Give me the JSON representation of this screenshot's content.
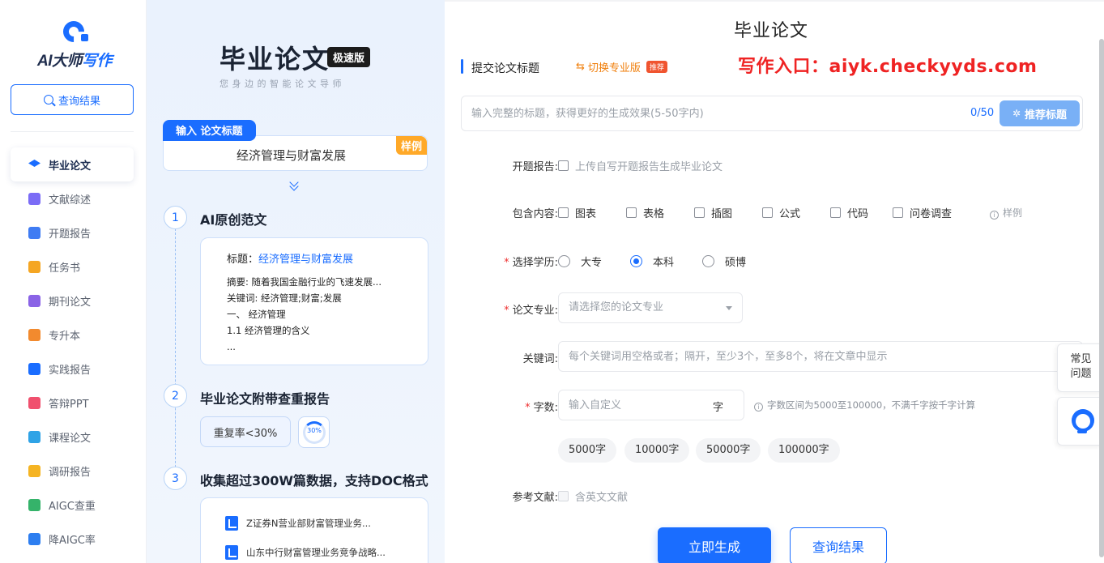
{
  "brand": {
    "logo_text_a": "AI大师",
    "logo_text_b": "写作"
  },
  "sidebar": {
    "query_button": "查询结果",
    "items": [
      {
        "label": "毕业论文",
        "icon": "graduation-cap-icon",
        "color": "#1a6dff",
        "active": true
      },
      {
        "label": "文献综述",
        "icon": "document-list-icon",
        "color": "#7b6cf6"
      },
      {
        "label": "开题报告",
        "icon": "report-icon",
        "color": "#3f7cf3"
      },
      {
        "label": "任务书",
        "icon": "task-edit-icon",
        "color": "#f5a623"
      },
      {
        "label": "期刊论文",
        "icon": "journal-icon",
        "color": "#8a63e6"
      },
      {
        "label": "专升本",
        "icon": "upgrade-icon",
        "color": "#f28a2e"
      },
      {
        "label": "实践报告",
        "icon": "practice-report-icon",
        "color": "#1a6dff"
      },
      {
        "label": "答辩PPT",
        "icon": "ppt-icon",
        "color": "#f0506e"
      },
      {
        "label": "课程论文",
        "icon": "course-paper-icon",
        "color": "#2fa3e6"
      },
      {
        "label": "调研报告",
        "icon": "survey-report-icon",
        "color": "#f5b423"
      },
      {
        "label": "AIGC查重",
        "icon": "aigc-check-icon",
        "color": "#35b36a"
      },
      {
        "label": "降AIGC率",
        "icon": "aigc-reduce-icon",
        "color": "#2d7ef0"
      }
    ]
  },
  "promo": {
    "title": "毕业论文",
    "badge": "极速版",
    "subtitle": "您身边的智能论文导师",
    "input_tag": "输入 论文标题",
    "input_value": "经济管理与财富发展",
    "sample_tag": "样例",
    "steps": [
      {
        "num": "1",
        "title": "AI原创范文"
      },
      {
        "num": "2",
        "title": "毕业论文附带查重报告"
      },
      {
        "num": "3",
        "title": "收集超过300W篇数据，支持DOC格式"
      }
    ],
    "sample": {
      "title_label": "标题：",
      "title_value": "经济管理与财富发展",
      "abstract": "摘要: 随着我国金融行业的飞速发展...",
      "keywords": "关键词: 经济管理;财富;发展",
      "h1": "一、 经济管理",
      "h11": "1.1 经济管理的含义",
      "ellipsis": "..."
    },
    "dup_rate": "重复率<30%",
    "dup_percent": "30%",
    "dup_progress": 0.3,
    "docs": [
      "Z证券N营业部财富管理业务...",
      "山东中行财富管理业务竞争战略..."
    ]
  },
  "main": {
    "title": "毕业论文",
    "section_label": "提交论文标题",
    "switch_label": "切换专业版",
    "recommend_tag": "推荐",
    "entry_text": "写作入口：aiyk.checkyyds.com",
    "title_placeholder": "输入完整的标题，获得更好的生成效果(5-50字内)",
    "title_counter": "0/50",
    "recommend_title_btn": "推荐标题",
    "opening_label": "开题报告:",
    "opening_option": "上传自写开题报告生成毕业论文",
    "include_label": "包含内容:",
    "include_options": [
      "图表",
      "表格",
      "插图",
      "公式",
      "代码",
      "问卷调查"
    ],
    "include_example": "样例",
    "degree_label": "选择学历:",
    "degree_options": [
      "大专",
      "本科",
      "硕博"
    ],
    "degree_selected": "本科",
    "major_label": "论文专业:",
    "major_placeholder": "请选择您的论文专业",
    "keyword_label": "关键词:",
    "keyword_placeholder": "每个关键词用空格或者；隔开，至少3个，至多8个，将在文章中显示",
    "words_label": "字数:",
    "words_placeholder": "输入自定义",
    "words_unit": "字",
    "words_hint": "字数区间为5000至100000，不满千字按千字计算",
    "word_chips": [
      "5000字",
      "10000字",
      "50000字",
      "100000字"
    ],
    "ref_label": "参考文献:",
    "ref_option": "含英文文献",
    "generate_btn": "立即生成",
    "result_btn": "查询结果"
  },
  "floating": {
    "faq": "常见问题",
    "faq_line1": "常见",
    "faq_line2": "问题",
    "service_icon": "customer-service-icon"
  }
}
